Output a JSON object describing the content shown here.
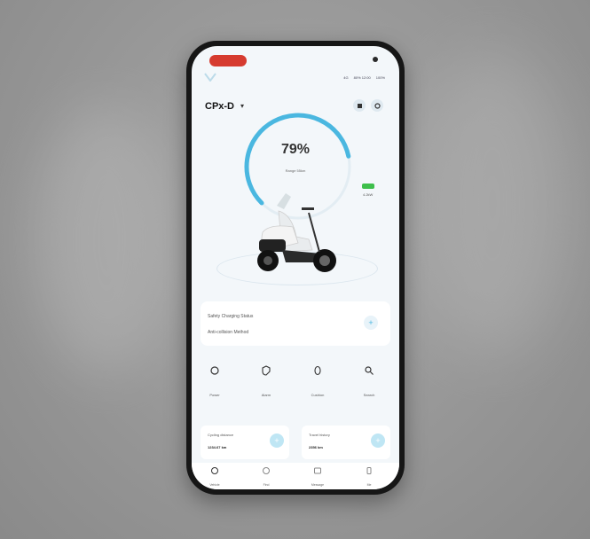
{
  "app": {
    "vehicle_name": "CPx-D",
    "battery_percent": "79%",
    "battery_level": 0.79,
    "range_text": "Range 55km",
    "charge_value": "4.2kW"
  },
  "status_bar": {
    "items": [
      "4G",
      "80% 12:00",
      "100%"
    ]
  },
  "info_card": {
    "line1": "Safety Charging Status",
    "line2": "Anti-collision Method"
  },
  "actions": [
    {
      "label": "Power",
      "icon": "power-icon"
    },
    {
      "label": "Alarm",
      "icon": "shield-icon"
    },
    {
      "label": "Cushion",
      "icon": "seat-icon"
    },
    {
      "label": "Search",
      "icon": "search-icon"
    }
  ],
  "stats": [
    {
      "title": "Cycling distance",
      "value": "1234.67 km"
    },
    {
      "title": "Travel history",
      "value": "2356 km"
    }
  ],
  "nav": [
    {
      "label": "Vehicle",
      "icon": "scooter-icon"
    },
    {
      "label": "Find",
      "icon": "location-icon"
    },
    {
      "label": "Message",
      "icon": "message-icon"
    },
    {
      "label": "Me",
      "icon": "profile-icon"
    }
  ],
  "colors": {
    "accent": "#4ab7e0",
    "charge": "#3dbf4b",
    "alert_pill": "#d63b2f"
  }
}
